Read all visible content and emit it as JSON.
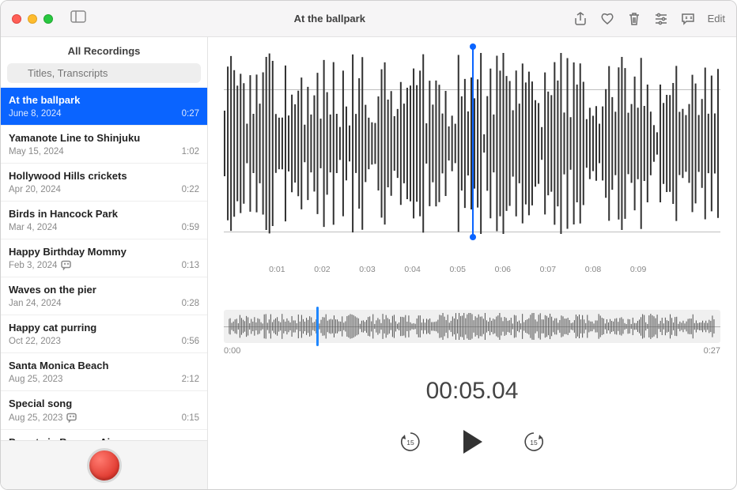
{
  "window": {
    "title": "At the ballpark"
  },
  "toolbar": {
    "edit_label": "Edit"
  },
  "sidebar": {
    "header": "All Recordings",
    "search_placeholder": "Titles, Transcripts",
    "items": [
      {
        "title": "At the ballpark",
        "date": "June 8, 2024",
        "duration": "0:27",
        "selected": true,
        "has_transcript": false
      },
      {
        "title": "Yamanote Line to Shinjuku",
        "date": "May 15, 2024",
        "duration": "1:02",
        "selected": false,
        "has_transcript": false
      },
      {
        "title": "Hollywood Hills crickets",
        "date": "Apr 20, 2024",
        "duration": "0:22",
        "selected": false,
        "has_transcript": false
      },
      {
        "title": "Birds in Hancock Park",
        "date": "Mar 4, 2024",
        "duration": "0:59",
        "selected": false,
        "has_transcript": false
      },
      {
        "title": "Happy Birthday Mommy",
        "date": "Feb 3, 2024",
        "duration": "0:13",
        "selected": false,
        "has_transcript": true
      },
      {
        "title": "Waves on the pier",
        "date": "Jan 24, 2024",
        "duration": "0:28",
        "selected": false,
        "has_transcript": false
      },
      {
        "title": "Happy cat purring",
        "date": "Oct 22, 2023",
        "duration": "0:56",
        "selected": false,
        "has_transcript": false
      },
      {
        "title": "Santa Monica Beach",
        "date": "Aug 25, 2023",
        "duration": "2:12",
        "selected": false,
        "has_transcript": false
      },
      {
        "title": "Special song",
        "date": "Aug 25, 2023",
        "duration": "0:15",
        "selected": false,
        "has_transcript": true
      },
      {
        "title": "Parrots in Buenos Aires",
        "date": "",
        "duration": "",
        "selected": false,
        "has_transcript": false
      }
    ]
  },
  "main": {
    "ruler_ticks": [
      "",
      "0:01",
      "0:02",
      "0:03",
      "0:04",
      "0:05",
      "0:06",
      "0:07",
      "0:08",
      "0:09",
      ""
    ],
    "playhead_position_fraction": 0.5,
    "overview_cursor_fraction": 0.187,
    "overview_start": "0:00",
    "overview_end": "0:27",
    "current_time": "00:05.04",
    "skip_back_amount": "15",
    "skip_forward_amount": "15"
  },
  "colors": {
    "accent": "#0a64ff",
    "record": "#e0392f"
  }
}
